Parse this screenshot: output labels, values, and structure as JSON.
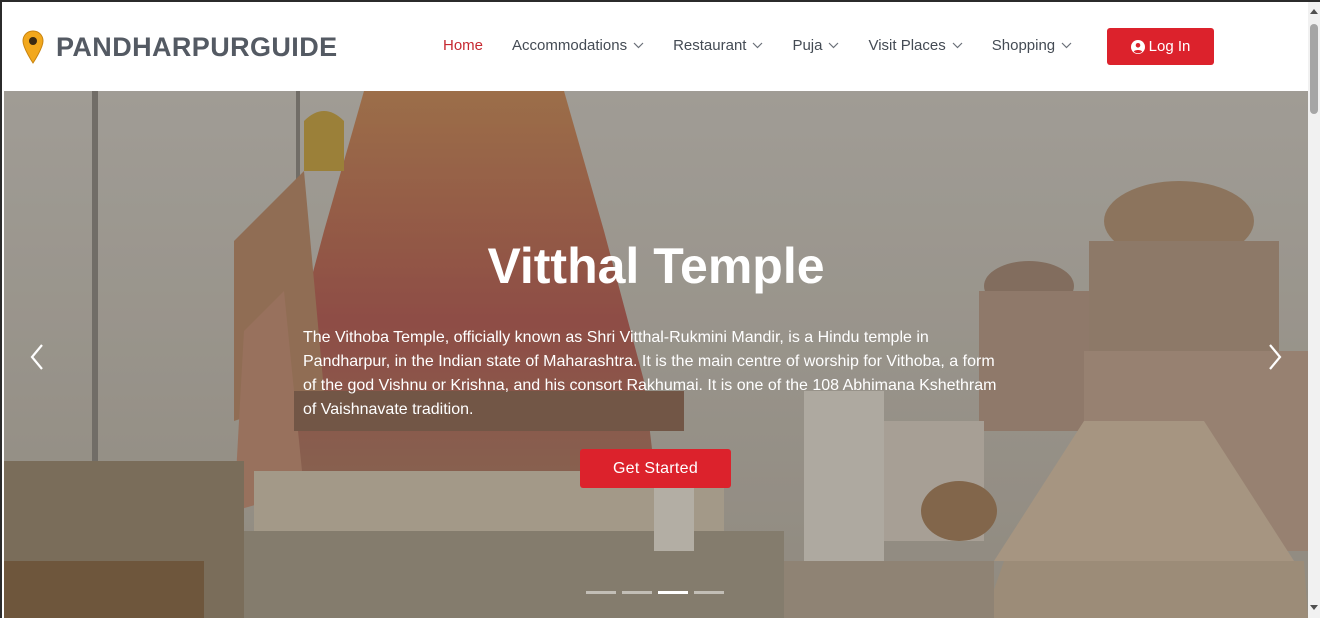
{
  "brand": {
    "name": "PANDHARPURGUIDE",
    "icon": "map-pin-icon"
  },
  "nav": {
    "items": [
      {
        "label": "Home",
        "active": true,
        "dropdown": false
      },
      {
        "label": "Accommodations",
        "active": false,
        "dropdown": true
      },
      {
        "label": "Restaurant",
        "active": false,
        "dropdown": true
      },
      {
        "label": "Puja",
        "active": false,
        "dropdown": true
      },
      {
        "label": "Visit Places",
        "active": false,
        "dropdown": true
      },
      {
        "label": "Shopping",
        "active": false,
        "dropdown": true
      }
    ],
    "login_label": "Log In",
    "login_icon": "user-circle-icon"
  },
  "hero": {
    "title": "Vitthal Temple",
    "description": "The Vithoba Temple, officially known as Shri Vitthal-Rukmini Mandir, is a Hindu temple in Pandharpur, in the Indian state of Maharashtra. It is the main centre of worship for Vithoba, a form of the god Vishnu or Krishna, and his consort Rakhumai. It is one of the 108 Abhimana Kshethram of Vaishnavate tradition.",
    "cta_label": "Get Started",
    "slides_count": 4,
    "active_slide": 3
  },
  "colors": {
    "accent": "#dc222c",
    "nav_active": "#c62931",
    "brand_text": "#545a63",
    "nav_text": "#444b54"
  }
}
